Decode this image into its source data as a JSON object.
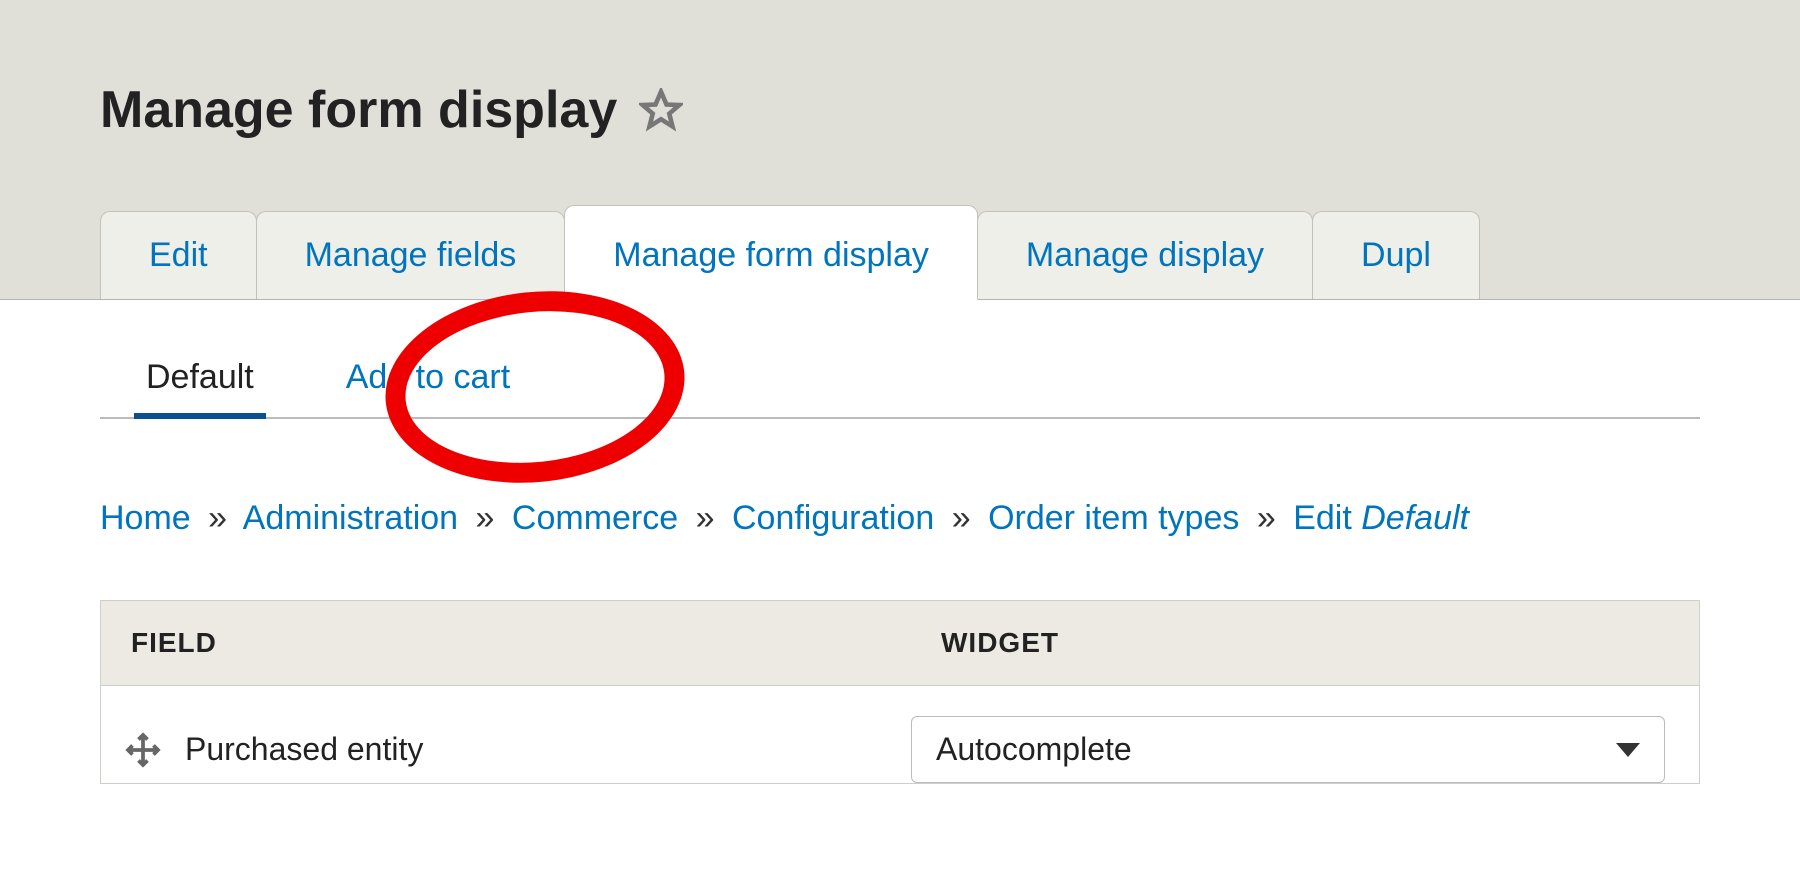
{
  "page_title": "Manage form display",
  "primary_tabs": [
    {
      "label": "Edit",
      "active": false
    },
    {
      "label": "Manage fields",
      "active": false
    },
    {
      "label": "Manage form display",
      "active": true
    },
    {
      "label": "Manage display",
      "active": false
    },
    {
      "label": "Dupl",
      "active": false
    }
  ],
  "secondary_tabs": [
    {
      "label": "Default",
      "active": true
    },
    {
      "label": "Add to cart",
      "active": false
    }
  ],
  "breadcrumb": {
    "items": [
      "Home",
      "Administration",
      "Commerce",
      "Configuration",
      "Order item types"
    ],
    "last_prefix": "Edit",
    "last_italic": "Default",
    "separator": "»"
  },
  "table": {
    "headers": {
      "field": "FIELD",
      "widget": "WIDGET"
    },
    "rows": [
      {
        "field": "Purchased entity",
        "widget": "Autocomplete"
      }
    ]
  },
  "annotation": {
    "highlight_target": "Add to cart"
  }
}
